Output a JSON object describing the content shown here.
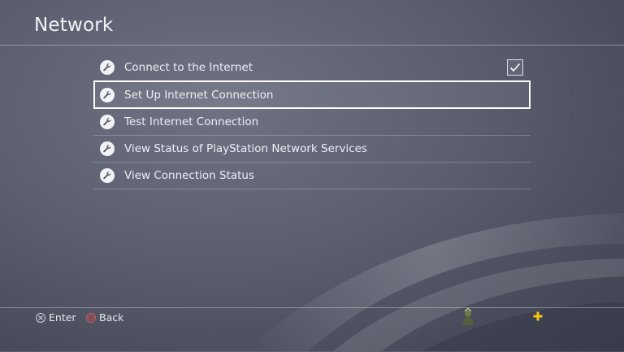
{
  "header": {
    "title": "Network"
  },
  "menu": {
    "items": [
      {
        "label": "Connect to the Internet",
        "checked": true
      },
      {
        "label": "Set Up Internet Connection",
        "selected": true
      },
      {
        "label": "Test Internet Connection"
      },
      {
        "label": "View Status of PlayStation Network Services"
      },
      {
        "label": "View Connection Status"
      }
    ]
  },
  "footer": {
    "enter_label": "Enter",
    "back_label": "Back"
  },
  "colors": {
    "cross_button": "#cfd3da",
    "circle_button": "#e04848",
    "plus_icon": "#f5c518"
  }
}
